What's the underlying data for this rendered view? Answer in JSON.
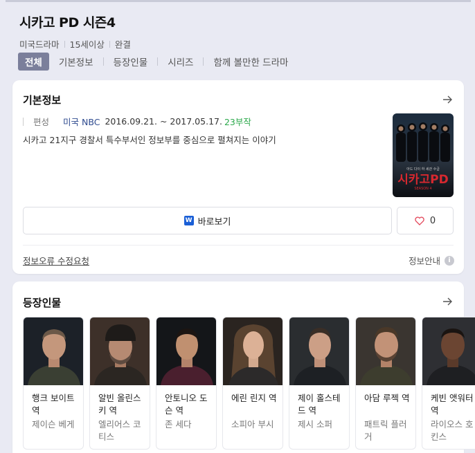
{
  "header": {
    "title": "시카고 PD 시즌4",
    "meta": [
      "미국드라마",
      "15세이상",
      "완결"
    ]
  },
  "tabs": [
    "전체",
    "기본정보",
    "등장인물",
    "시리즈",
    "함께 볼만한 드라마"
  ],
  "basic": {
    "title": "기본정보",
    "label": "편성",
    "broadcaster": "미국 NBC",
    "dates": "2016.09.21. ~ 2017.05.17.",
    "episodes": "23부작",
    "synopsis": "시카고 21지구 경찰서 특수부서인 정보부를 중심으로 펼쳐지는 이야기",
    "poster": {
      "top_text": "아드 다이 하 세관 수급",
      "title": "시카고PD",
      "sub": "SEASON 4"
    },
    "watch_label": "바로보기",
    "watch_logo": "W",
    "like_count": "0",
    "report_link": "정보오류 수정요청",
    "info_guide": "정보안내",
    "info_icon": "i"
  },
  "cast_section": {
    "title": "등장인물",
    "items": [
      {
        "role": "행크 보이트 역",
        "actor": "제이슨 베게"
      },
      {
        "role": "알빈 올린스키 역",
        "actor": "엘리어스 코티스"
      },
      {
        "role": "안토니오 도슨 역",
        "actor": "존 세다"
      },
      {
        "role": "에린 린지 역",
        "actor": "소피아 부시"
      },
      {
        "role": "제이 홀스테드 역",
        "actor": "제시 소퍼"
      },
      {
        "role": "아담 루젝 역",
        "actor": "패트릭 플러거"
      },
      {
        "role": "케빈 앳워터 역",
        "actor": "라이오스 호킨스"
      }
    ]
  },
  "colors": {
    "background": "#e9eaf3",
    "active_tab": "#7b7f9b",
    "episodes": "#2aa84a",
    "broadcaster": "#2e4a8f",
    "heart": "#e3475a",
    "watch_logo": "#1a5fd6"
  }
}
